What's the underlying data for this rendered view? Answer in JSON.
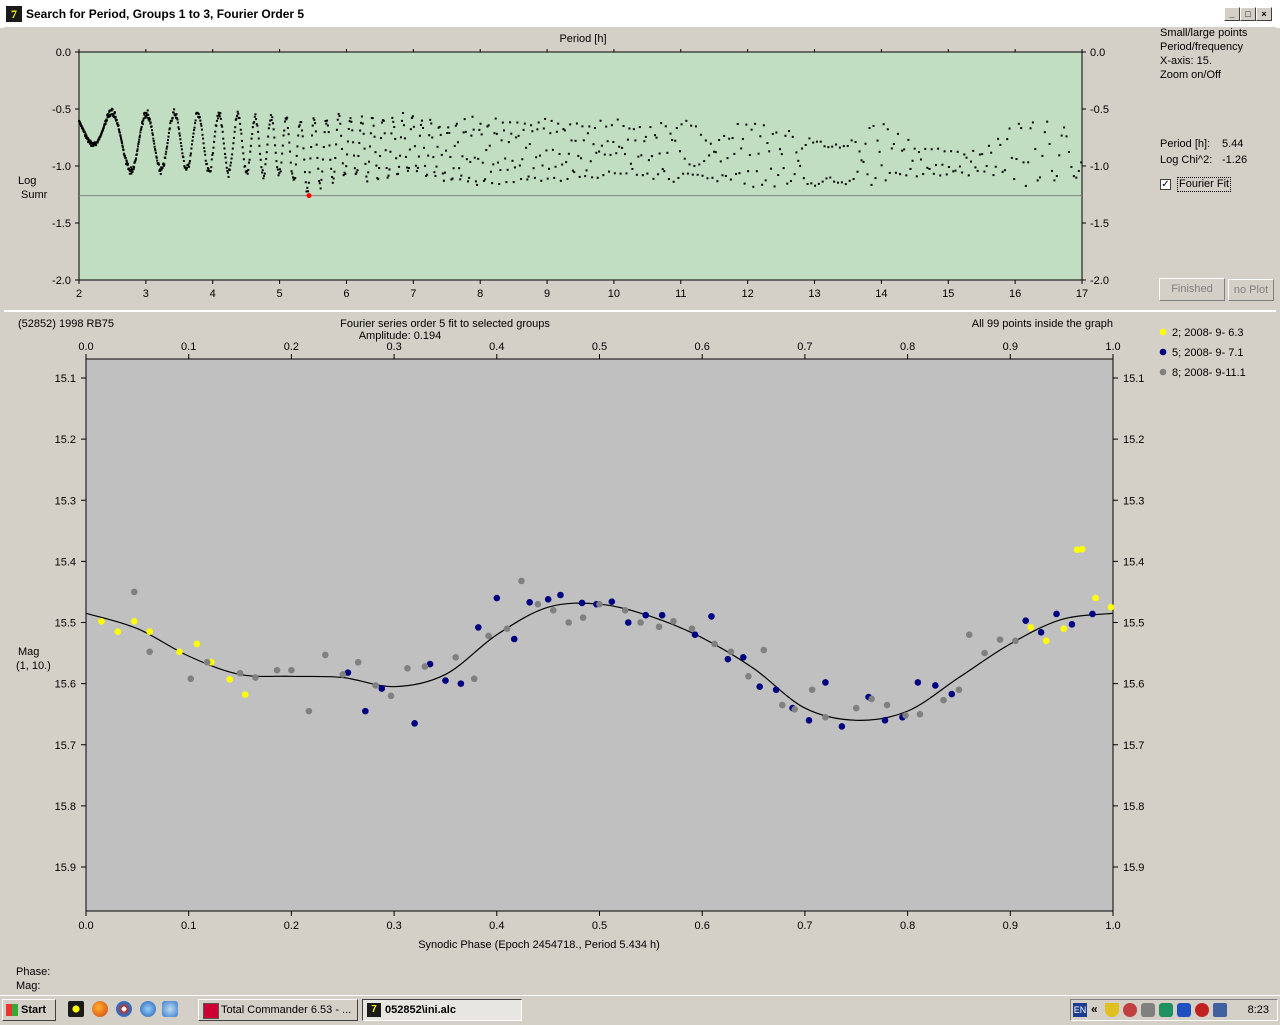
{
  "window": {
    "title": "Search for Period, Groups 1 to 3, Fourier Order 5",
    "icon_text": "7"
  },
  "periodogram": {
    "x_title": "Period [h]",
    "y_label_1": "Log",
    "y_label_2": "Sumr",
    "x_ticks": [
      "2",
      "3",
      "4",
      "5",
      "6",
      "7",
      "8",
      "9",
      "10",
      "11",
      "12",
      "13",
      "14",
      "15",
      "16",
      "17"
    ],
    "y_ticks": [
      "0.0",
      "-0.5",
      "-1.0",
      "-1.5",
      "-2.0"
    ],
    "best": {
      "period": 5.44,
      "log": -1.26
    },
    "plot_bg": "#c2dec2",
    "chart_data": {
      "type": "scatter",
      "xlabel": "Period [h]",
      "ylabel": "Log Sumr",
      "xlim": [
        2,
        17
      ],
      "ylim": [
        -2.0,
        0.0
      ],
      "reference_line": -1.26,
      "envelope_x": [
        2.0,
        2.5,
        3.0,
        3.5,
        4.0,
        4.5,
        5.0,
        5.44,
        6.0,
        6.5,
        7.0,
        7.5,
        8.0,
        8.5,
        9.0,
        9.5,
        10.0,
        10.5,
        11.0,
        11.5,
        12.0,
        12.5,
        13.0,
        13.5,
        14.0,
        14.5,
        15.0,
        15.5,
        16.0,
        16.5,
        17.0
      ],
      "envelope_upper": [
        -0.47,
        -0.49,
        -0.5,
        -0.5,
        -0.5,
        -0.52,
        -0.54,
        -0.56,
        -0.52,
        -0.55,
        -0.52,
        -0.6,
        -0.55,
        -0.58,
        -0.55,
        -0.62,
        -0.58,
        -0.65,
        -0.55,
        -0.75,
        -0.55,
        -0.65,
        -0.75,
        -0.78,
        -0.55,
        -0.8,
        -0.85,
        -0.85,
        -0.55,
        -0.6,
        -0.7
      ],
      "envelope_lower": [
        -0.7,
        -1.05,
        -1.1,
        -1.05,
        -1.1,
        -1.1,
        -1.12,
        -1.26,
        -1.12,
        -1.15,
        -1.1,
        -1.18,
        -1.2,
        -1.15,
        -1.18,
        -1.15,
        -1.1,
        -1.12,
        -1.2,
        -1.15,
        -1.2,
        -1.18,
        -1.2,
        -1.18,
        -1.18,
        -1.1,
        -1.12,
        -1.08,
        -1.18,
        -1.18,
        -1.15
      ]
    }
  },
  "side_panel": {
    "opt1": "Small/large points",
    "opt2": "Period/frequency",
    "opt3": "X-axis: 15.",
    "opt4": "Zoom on/Off",
    "period_label": "Period [h]:",
    "period_value": "5.44",
    "logchi_label": "Log Chi^2:",
    "logchi_value": "-1.26",
    "fourier_label": "Fourier Fit",
    "fourier_checked": true,
    "finished_label": "Finished",
    "noplot_label": "no Plot"
  },
  "lightcurve": {
    "object": "(52852) 1998 RB75",
    "fit_title": "Fourier series order 5 fit to selected groups",
    "amplitude": "Amplitude: 0.194",
    "inside": "All 99 points inside the graph",
    "y_label_1": "Mag",
    "y_label_2": "(1, 10.)",
    "x_label": "Synodic Phase (Epoch 2454718., Period 5.434 h)",
    "x_ticks": [
      "0.0",
      "0.1",
      "0.2",
      "0.3",
      "0.4",
      "0.5",
      "0.6",
      "0.7",
      "0.8",
      "0.9",
      "1.0"
    ],
    "y_ticks": [
      "15.1",
      "15.2",
      "15.3",
      "15.4",
      "15.5",
      "15.6",
      "15.7",
      "15.8",
      "15.9"
    ],
    "legend": [
      {
        "label": "2; 2008- 9- 6.3",
        "color": "#ffff00"
      },
      {
        "label": "5; 2008- 9- 7.1",
        "color": "#000080"
      },
      {
        "label": "8; 2008- 9-11.1",
        "color": "#808080"
      }
    ],
    "plot_bg": "#c0c0c0",
    "chart_data": {
      "type": "scatter",
      "xlabel": "Synodic Phase (Epoch 2454718., Period 5.434 h)",
      "ylabel": "Mag (1, 10.)",
      "xlim": [
        0.0,
        1.0
      ],
      "ylim": [
        15.1,
        15.9
      ],
      "y_inverted": true,
      "series": [
        {
          "name": "2; 2008- 9- 6.3",
          "color": "#ffff00",
          "x": [
            0.015,
            0.031,
            0.047,
            0.062,
            0.091,
            0.108,
            0.122,
            0.14,
            0.155,
            0.965,
            0.92,
            0.935,
            0.952,
            0.97,
            0.983,
            0.998
          ],
          "y": [
            15.498,
            15.515,
            15.498,
            15.515,
            15.548,
            15.535,
            15.565,
            15.593,
            15.618,
            15.381,
            15.508,
            15.53,
            15.51,
            15.38,
            15.46,
            15.475
          ]
        },
        {
          "name": "5; 2008- 9- 7.1",
          "color": "#000080",
          "x": [
            0.255,
            0.272,
            0.288,
            0.32,
            0.335,
            0.35,
            0.365,
            0.382,
            0.4,
            0.417,
            0.432,
            0.45,
            0.462,
            0.483,
            0.497,
            0.512,
            0.528,
            0.545,
            0.561,
            0.593,
            0.609,
            0.625,
            0.64,
            0.656,
            0.672,
            0.688,
            0.704,
            0.72,
            0.736,
            0.762,
            0.778,
            0.795,
            0.81,
            0.827,
            0.843,
            0.915,
            0.93,
            0.945,
            0.96,
            0.98
          ],
          "y": [
            15.582,
            15.645,
            15.608,
            15.665,
            15.568,
            15.595,
            15.6,
            15.508,
            15.46,
            15.527,
            15.467,
            15.462,
            15.455,
            15.468,
            15.47,
            15.466,
            15.5,
            15.488,
            15.488,
            15.52,
            15.49,
            15.56,
            15.557,
            15.605,
            15.61,
            15.64,
            15.66,
            15.598,
            15.67,
            15.622,
            15.66,
            15.655,
            15.598,
            15.603,
            15.617,
            15.497,
            15.516,
            15.486,
            15.503,
            15.486
          ]
        },
        {
          "name": "8; 2008- 9-11.1",
          "color": "#808080",
          "x": [
            0.047,
            0.062,
            0.102,
            0.118,
            0.15,
            0.165,
            0.186,
            0.2,
            0.217,
            0.233,
            0.25,
            0.265,
            0.282,
            0.297,
            0.313,
            0.33,
            0.36,
            0.378,
            0.392,
            0.41,
            0.424,
            0.44,
            0.455,
            0.47,
            0.484,
            0.5,
            0.525,
            0.54,
            0.558,
            0.572,
            0.59,
            0.612,
            0.628,
            0.645,
            0.66,
            0.678,
            0.69,
            0.707,
            0.72,
            0.75,
            0.765,
            0.78,
            0.798,
            0.812,
            0.835,
            0.85,
            0.86,
            0.875,
            0.89,
            0.905
          ],
          "y": [
            15.45,
            15.548,
            15.592,
            15.565,
            15.583,
            15.59,
            15.578,
            15.578,
            15.645,
            15.553,
            15.585,
            15.565,
            15.603,
            15.62,
            15.575,
            15.572,
            15.557,
            15.592,
            15.522,
            15.51,
            15.432,
            15.47,
            15.48,
            15.5,
            15.492,
            15.47,
            15.48,
            15.5,
            15.507,
            15.498,
            15.51,
            15.535,
            15.548,
            15.588,
            15.545,
            15.635,
            15.642,
            15.61,
            15.655,
            15.64,
            15.625,
            15.635,
            15.652,
            15.65,
            15.627,
            15.61,
            15.52,
            15.55,
            15.528,
            15.53
          ]
        }
      ],
      "fit_x": [
        0.0,
        0.05,
        0.1,
        0.15,
        0.2,
        0.25,
        0.3,
        0.35,
        0.4,
        0.45,
        0.5,
        0.55,
        0.6,
        0.65,
        0.7,
        0.75,
        0.8,
        0.85,
        0.9,
        0.95,
        1.0
      ],
      "fit_y": [
        15.485,
        15.51,
        15.555,
        15.585,
        15.588,
        15.59,
        15.605,
        15.585,
        15.52,
        15.475,
        15.47,
        15.49,
        15.525,
        15.575,
        15.64,
        15.66,
        15.645,
        15.59,
        15.535,
        15.495,
        15.485
      ]
    }
  },
  "status": {
    "phase_label": "Phase:",
    "mag_label": "Mag:"
  },
  "taskbar": {
    "start": "Start",
    "tasks": [
      {
        "label": "Total Commander 6.53 - ..."
      },
      {
        "label": "052852\\ini.alc"
      }
    ],
    "lang": "EN",
    "clock": "8:23"
  }
}
